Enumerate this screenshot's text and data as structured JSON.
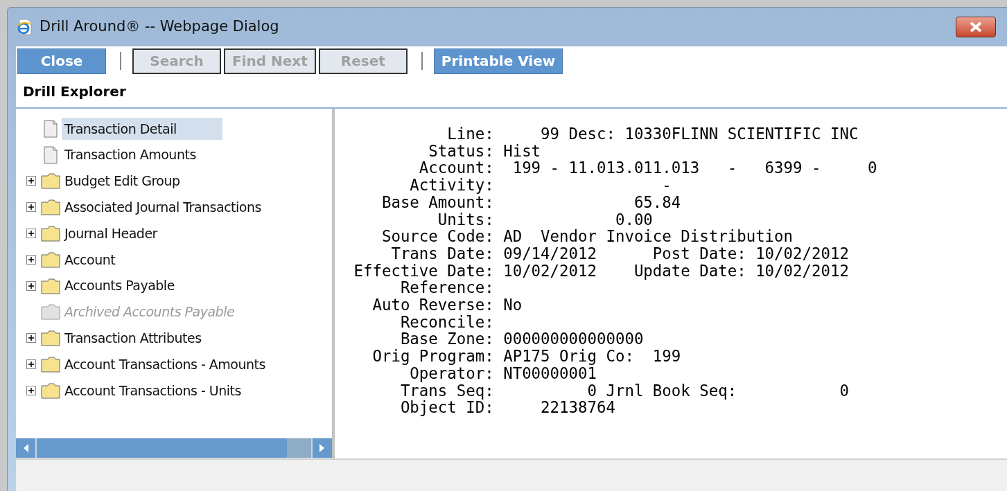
{
  "window": {
    "title": "Drill Around® -- Webpage Dialog"
  },
  "toolbar": [
    {
      "kind": "button",
      "label": "Close",
      "disabled": false
    },
    {
      "kind": "separator"
    },
    {
      "kind": "button",
      "label": "Search",
      "disabled": true
    },
    {
      "kind": "button",
      "label": "Find Next",
      "disabled": true
    },
    {
      "kind": "button",
      "label": "Reset",
      "disabled": true
    },
    {
      "kind": "separator"
    },
    {
      "kind": "button",
      "label": "Printable View",
      "disabled": false
    }
  ],
  "section_title": "Drill Explorer",
  "tree": [
    {
      "label": "Transaction Detail",
      "kind": "document",
      "expandable": false,
      "disabled": false,
      "selected": true
    },
    {
      "label": "Transaction Amounts",
      "kind": "document",
      "expandable": false,
      "disabled": false,
      "selected": false
    },
    {
      "label": "Budget Edit Group",
      "kind": "folder",
      "expandable": true,
      "disabled": false,
      "selected": false
    },
    {
      "label": "Associated Journal Transactions",
      "kind": "folder",
      "expandable": true,
      "disabled": false,
      "selected": false
    },
    {
      "label": "Journal Header",
      "kind": "folder",
      "expandable": true,
      "disabled": false,
      "selected": false
    },
    {
      "label": "Account",
      "kind": "folder",
      "expandable": true,
      "disabled": false,
      "selected": false
    },
    {
      "label": "Accounts Payable",
      "kind": "folder",
      "expandable": true,
      "disabled": false,
      "selected": false
    },
    {
      "label": "Archived Accounts Payable",
      "kind": "folder",
      "expandable": false,
      "disabled": true,
      "selected": false
    },
    {
      "label": "Transaction Attributes",
      "kind": "folder",
      "expandable": true,
      "disabled": false,
      "selected": false
    },
    {
      "label": "Account Transactions - Amounts",
      "kind": "folder",
      "expandable": true,
      "disabled": false,
      "selected": false
    },
    {
      "label": "Account Transactions - Units",
      "kind": "folder",
      "expandable": true,
      "disabled": false,
      "selected": false
    }
  ],
  "detail_lines": [
    "           Line:     99 Desc: 10330FLINN SCIENTIFIC INC",
    "         Status: Hist",
    "        Account:  199 - 11.013.011.013   -   6399 -     0",
    "       Activity:                  -",
    "    Base Amount:               65.84",
    "          Units:             0.00",
    "    Source Code: AD  Vendor Invoice Distribution",
    "     Trans Date: 09/14/2012      Post Date: 10/02/2012",
    " Effective Date: 10/02/2012    Update Date: 10/02/2012",
    "      Reference:",
    "   Auto Reverse: No",
    "      Reconcile:",
    "      Base Zone: 000000000000000",
    "   Orig Program: AP175 Orig Co:  199",
    "       Operator: NT00000001",
    "      Trans Seq:          0 Jrnl Book Seq:           0",
    "      Object ID:     22138764"
  ]
}
